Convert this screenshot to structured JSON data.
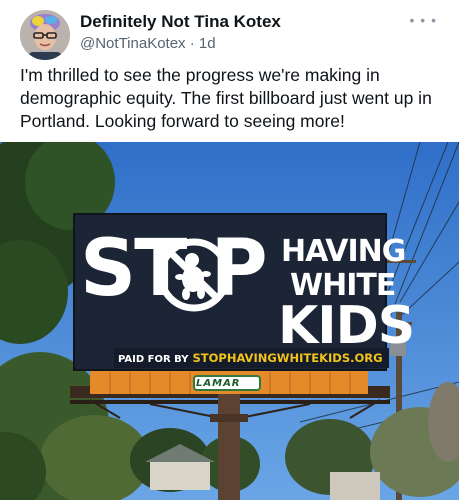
{
  "tweet": {
    "display_name": "Definitely Not Tina Kotex",
    "handle": "@NotTinaKotex",
    "separator": "·",
    "time": "1d",
    "more_icon": "ellipsis-icon",
    "text": "I'm thrilled to see the progress we're making in demographic equity.  The first billboard just went up in Portland.  Looking forward to seeing more!"
  },
  "billboard": {
    "word_stop": "ST P",
    "line_having": "HAVING",
    "line_white": "WHITE",
    "line_kids": "KIDS",
    "paid_for_label": "PAID FOR BY",
    "paid_for_url": "STOPHAVINGWHITEKIDS.ORG",
    "owner_sign": "LAMAR",
    "icon": "no-baby-prohibition-icon"
  },
  "colors": {
    "sky": "#3f7fd2",
    "billboard_bg": "#1c2535",
    "url_yellow": "#f2c31a",
    "panel_orange": "#e58a2b",
    "handle_gray": "#536471"
  }
}
